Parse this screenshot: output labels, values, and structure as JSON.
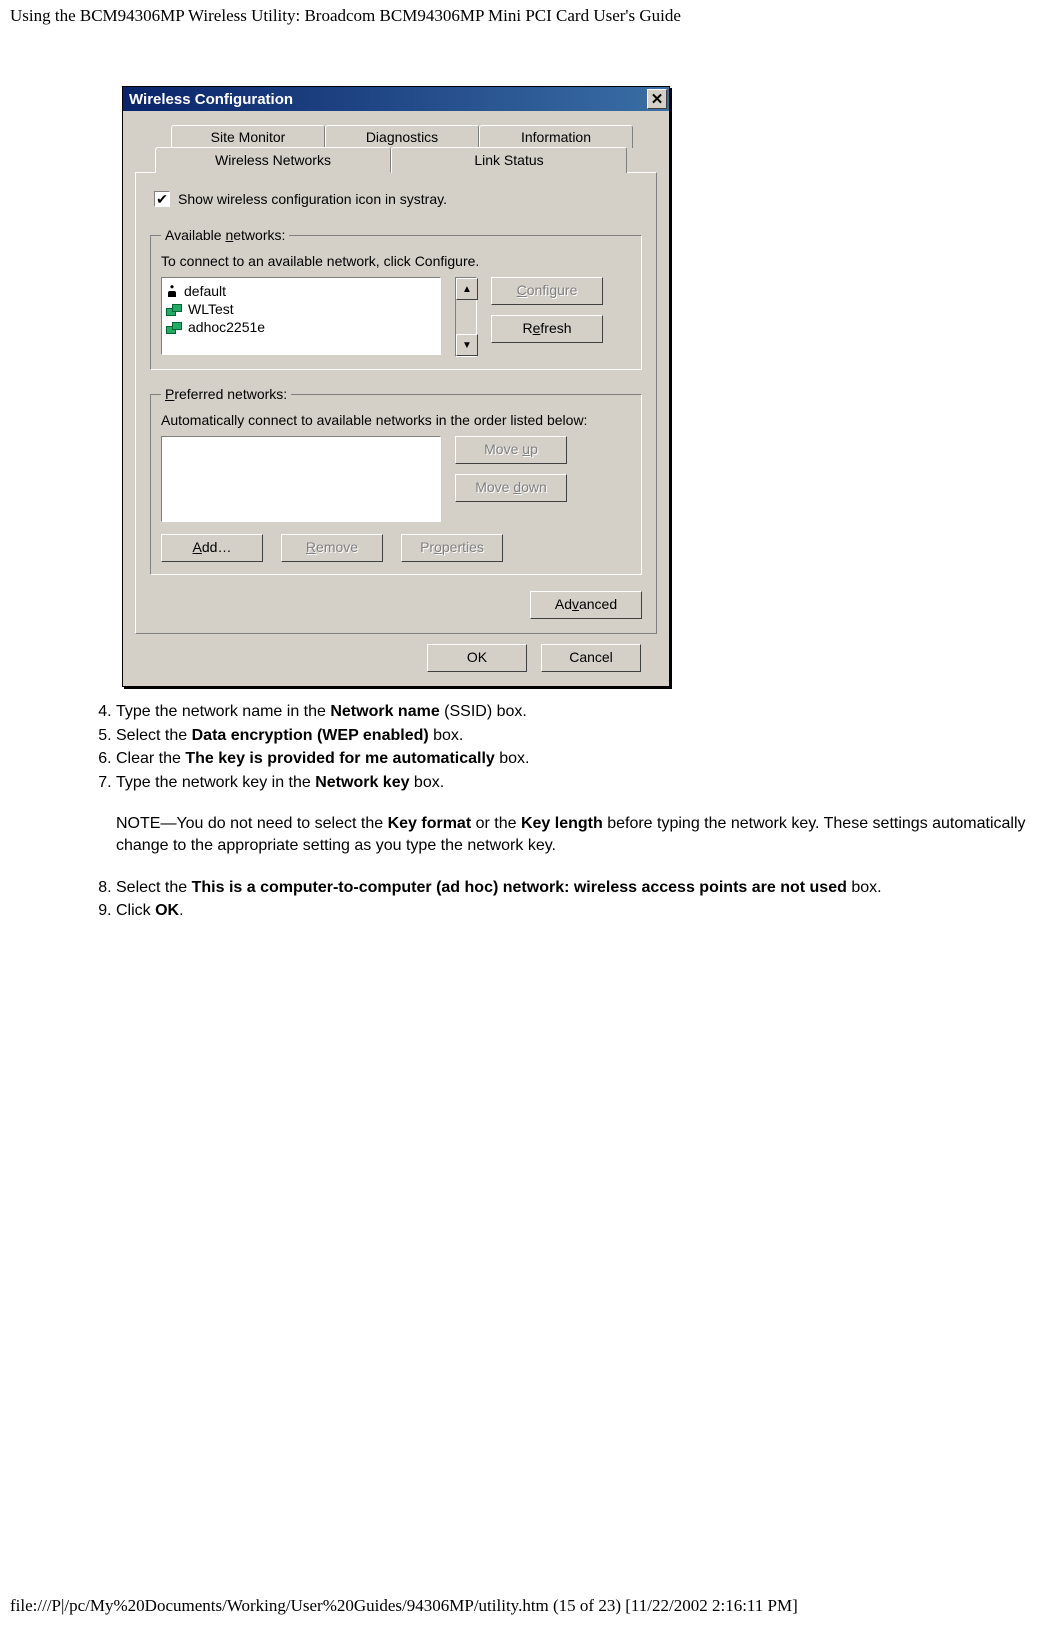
{
  "doc": {
    "header": "Using the BCM94306MP Wireless Utility: Broadcom BCM94306MP Mini PCI Card User's Guide",
    "footer": "file:///P|/pc/My%20Documents/Working/User%20Guides/94306MP/utility.htm (15 of 23) [11/22/2002 2:16:11 PM]"
  },
  "dialog": {
    "title": "Wireless Configuration",
    "tabs_back": [
      "Site Monitor",
      "Diagnostics",
      "Information"
    ],
    "tabs_front": [
      "Wireless Networks",
      "Link Status"
    ],
    "systray_label": "Show wireless configuration icon in systray.",
    "available": {
      "legend_pre": "Available ",
      "legend_u": "n",
      "legend_post": "etworks:",
      "desc": "To connect to an available network, click Configure.",
      "items": [
        "default",
        "WLTest",
        "adhoc2251e"
      ],
      "configure_u": "C",
      "configure_post": "onfigure",
      "refresh_pre": "R",
      "refresh_u": "e",
      "refresh_post": "fresh"
    },
    "preferred": {
      "legend_u": "P",
      "legend_post": "referred networks:",
      "desc": "Automatically connect to available networks in the order listed below:",
      "moveup_pre": "Move ",
      "moveup_u": "u",
      "moveup_post": "p",
      "movedown_pre": "Move ",
      "movedown_u": "d",
      "movedown_post": "own",
      "add_u": "A",
      "add_post": "dd…",
      "remove_u": "R",
      "remove_post": "emove",
      "properties_pre": "Pr",
      "properties_u": "o",
      "properties_post": "perties"
    },
    "advanced_pre": "Ad",
    "advanced_u": "v",
    "advanced_post": "anced",
    "ok": "OK",
    "cancel": "Cancel"
  },
  "steps": {
    "s4a": "Type the network name in the ",
    "s4b": "Network name",
    "s4c": " (SSID) box.",
    "s5a": "Select the ",
    "s5b": "Data encryption (WEP enabled)",
    "s5c": " box.",
    "s6a": "Clear the ",
    "s6b": "The key is provided for me automatically",
    "s6c": " box.",
    "s7a": "Type the network key in the ",
    "s7b": "Network key",
    "s7c": " box.",
    "note1": "NOTE—You do not need to select the ",
    "note_b1": "Key format",
    "note2": " or the ",
    "note_b2": "Key length",
    "note3": " before typing the network key. These settings automatically change to the appropriate setting as you type the network key.",
    "s8a": "Select the ",
    "s8b": "This is a computer-to-computer (ad hoc) network: wireless access points are not used",
    "s8c": " box.",
    "s9a": "Click ",
    "s9b": "OK",
    "s9c": "."
  }
}
